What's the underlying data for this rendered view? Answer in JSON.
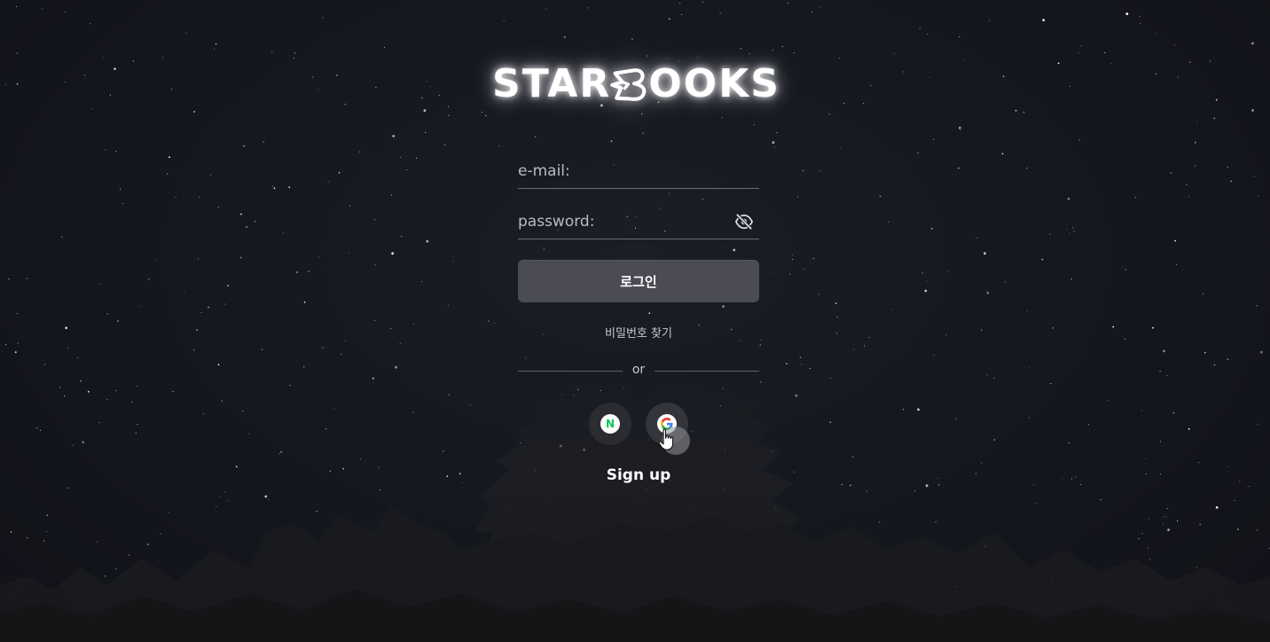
{
  "brand": {
    "logo_left": "STAR",
    "logo_right": "OOKS",
    "logo_full": "STARBOOKS"
  },
  "login_form": {
    "email_placeholder": "e-mail:",
    "password_placeholder": "password:",
    "password_visibility_icon": "eye-off-icon",
    "submit_label": "로그인",
    "find_password_label": "비밀번호 찾기",
    "divider_label": "or"
  },
  "social_login": {
    "providers": [
      {
        "name": "Naver",
        "icon": "naver-icon",
        "mark": "N",
        "color": "#03c75a"
      },
      {
        "name": "Google",
        "icon": "google-icon"
      }
    ]
  },
  "signup": {
    "label": "Sign up"
  },
  "colors": {
    "background": "#161821",
    "button": "#4a4b54",
    "text": "#ffffff",
    "naver_green": "#03c75a"
  }
}
